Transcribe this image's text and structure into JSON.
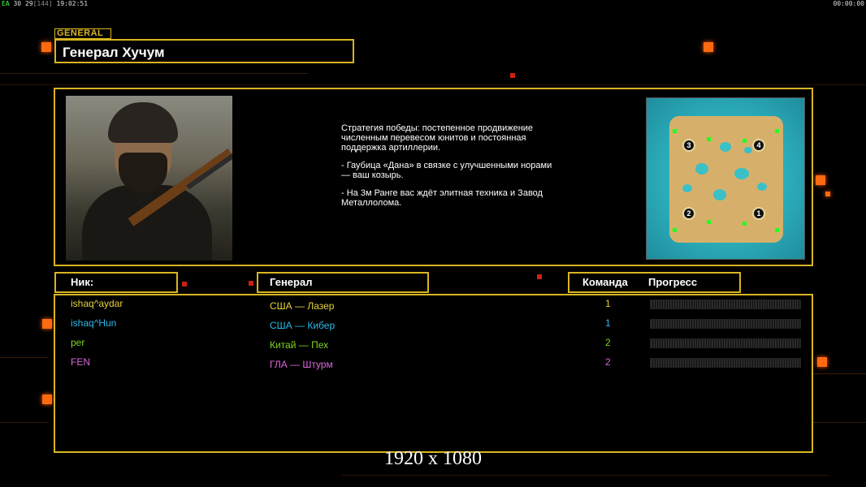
{
  "topbar": {
    "left_prefix": "EA",
    "left_fps": "30",
    "left_num": "29",
    "left_bracket": "[144]",
    "left_time": "19:02:51",
    "right_time": "00:00:00"
  },
  "general_tag": "GENERAL",
  "general_name": "Генерал Хучум",
  "description": {
    "p1": "Стратегия победы: постепенное продвижение численным перевесом юнитов и постоянная поддержка артиллерии.",
    "p2": "- Гаубица «Дана» в связке с улучшенными норами — ваш козырь.",
    "p3": "- На 3м Ранге вас ждёт элитная техника и Завод Металлолома."
  },
  "map": {
    "slots": [
      "3",
      "4",
      "2",
      "1"
    ]
  },
  "headers": {
    "nick": "Ник:",
    "general": "Генерал",
    "team": "Команда",
    "progress": "Прогресс"
  },
  "players": [
    {
      "nick": "ishaq^aydar",
      "general": "США — Лазер",
      "team": "1",
      "color": "#e6d23a",
      "progress": 0
    },
    {
      "nick": "ishaq^Hun",
      "general": "США — Кибер",
      "team": "1",
      "color": "#2ab8e8",
      "progress": 0
    },
    {
      "nick": "per",
      "general": "Китай — Пех",
      "team": "2",
      "color": "#7fd41e",
      "progress": 0
    },
    {
      "nick": "FEN",
      "general": "ГЛА — Штурм",
      "team": "2",
      "color": "#d968d9",
      "progress": 0
    }
  ],
  "resolution_label": "1920 x 1080",
  "colors": {
    "accent": "#d9b521",
    "background": "#000000",
    "glow": "#ff6a10"
  }
}
